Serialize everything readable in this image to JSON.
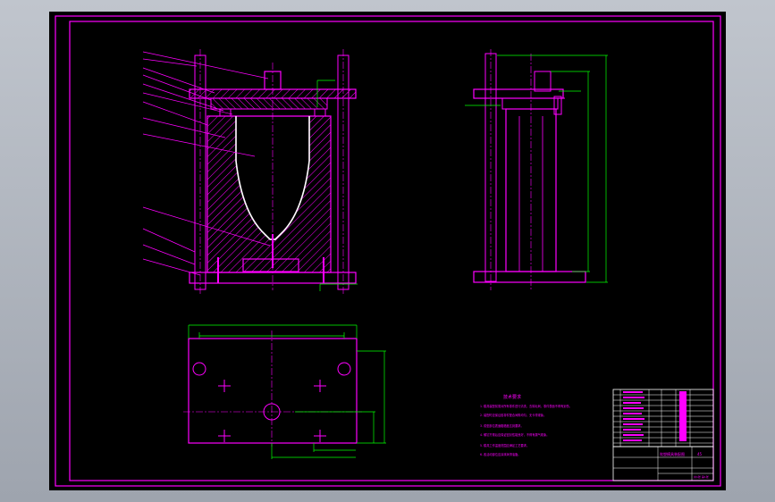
{
  "colors": {
    "background": "#000000",
    "magenta": "#ff00ff",
    "green": "#00ff00",
    "white": "#ffffff",
    "gray": "#b8bdc6"
  },
  "technical_requirements": {
    "title": "技术要求",
    "lines": [
      "1. 模具装配前需对所有零件进行清洗，去除毛刺，零件表面不得有划伤。",
      "2. 装配时应保证各零件配合间隙均匀，无卡滞现象。",
      "3. 成型部位表面粗糙度达到要求。",
      "4. 螺钉拧紧后应保证密封性能良好，不得有漏气现象。",
      "5. 模具工作温度范围应满足工艺要求。",
      "6. 各活动部位应涂抹润滑油脂。"
    ]
  },
  "title_block": {
    "drawing_name": "吹塑模具装配图",
    "material": "45",
    "sheet": "共1张 第1张"
  }
}
